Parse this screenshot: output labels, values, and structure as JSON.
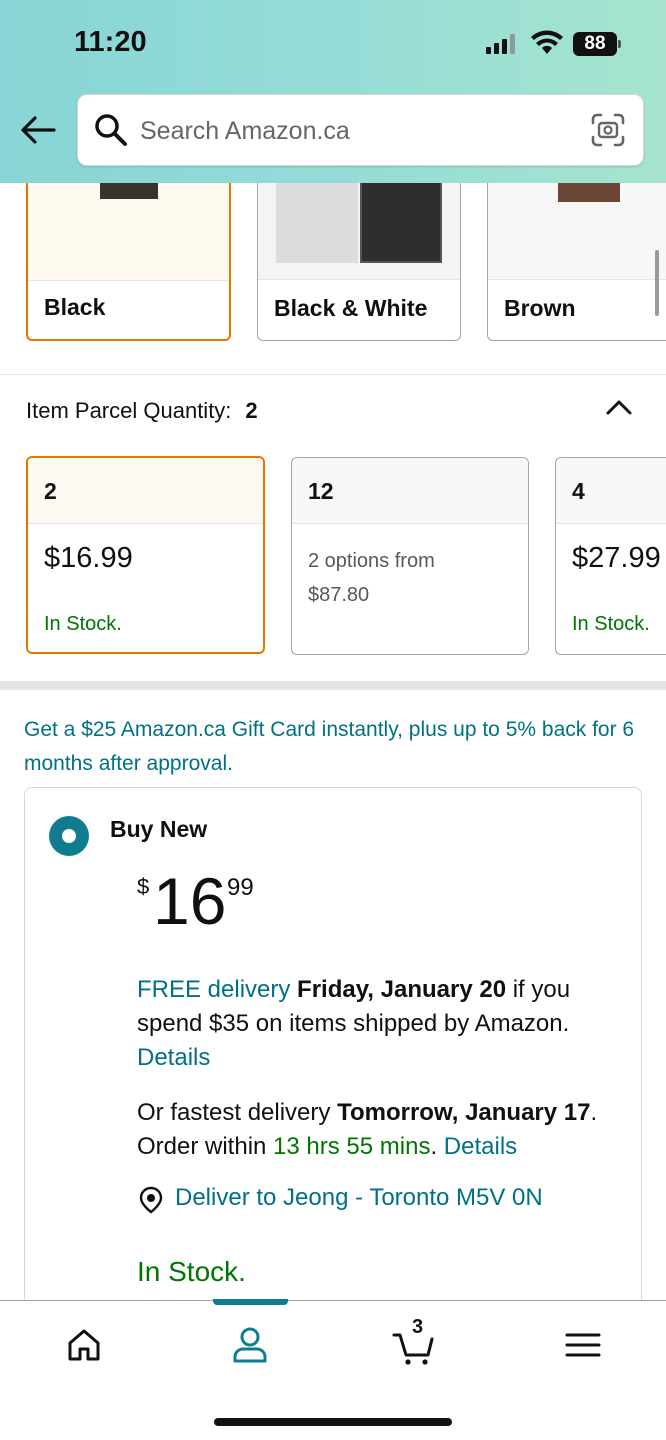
{
  "status_bar": {
    "time": "11:20",
    "battery": "88"
  },
  "search": {
    "placeholder": "Search Amazon.ca"
  },
  "colors": {
    "options": [
      {
        "label": "Black",
        "selected": true
      },
      {
        "label": "Black & White",
        "selected": false
      },
      {
        "label": "Brown",
        "selected": false
      }
    ]
  },
  "quantity": {
    "title": "Item Parcel Quantity:",
    "selected_value": "2",
    "options": [
      {
        "label": "2",
        "price": "$16.99",
        "stock": "In Stock.",
        "selected": true
      },
      {
        "label": "12",
        "options_line1": "2 options from",
        "options_line2": "$87.80",
        "selected": false
      },
      {
        "label": "4",
        "price": "$27.99",
        "stock": "In Stock.",
        "selected": false
      }
    ]
  },
  "promo": {
    "text": "Get a $25 Amazon.ca Gift Card instantly, plus up to 5% back for 6 months after approval."
  },
  "buy_box": {
    "label": "Buy New",
    "price_symbol": "$",
    "price_whole": "16",
    "price_fraction": "99",
    "free_delivery_link": "FREE delivery",
    "delivery_date": "Friday, January 20",
    "delivery_condition": "if you spend $35 on items shipped by Amazon.",
    "details_link_1": "Details",
    "fastest_prefix": "Or fastest delivery",
    "fastest_date": "Tomorrow, January 17",
    "order_within_prefix": ". Order within",
    "order_within_time": "13 hrs 55 mins",
    "details_link_2": "Details",
    "deliver_to": "Deliver to Jeong - Toronto M5V 0N",
    "stock": "In Stock."
  },
  "bottom_nav": {
    "cart_count": "3",
    "active_tab": "account"
  },
  "accent_colors": {
    "teal": "#007185",
    "orange_selected": "#e77600",
    "green_stock": "#007600",
    "radio": "#0f7c90"
  }
}
